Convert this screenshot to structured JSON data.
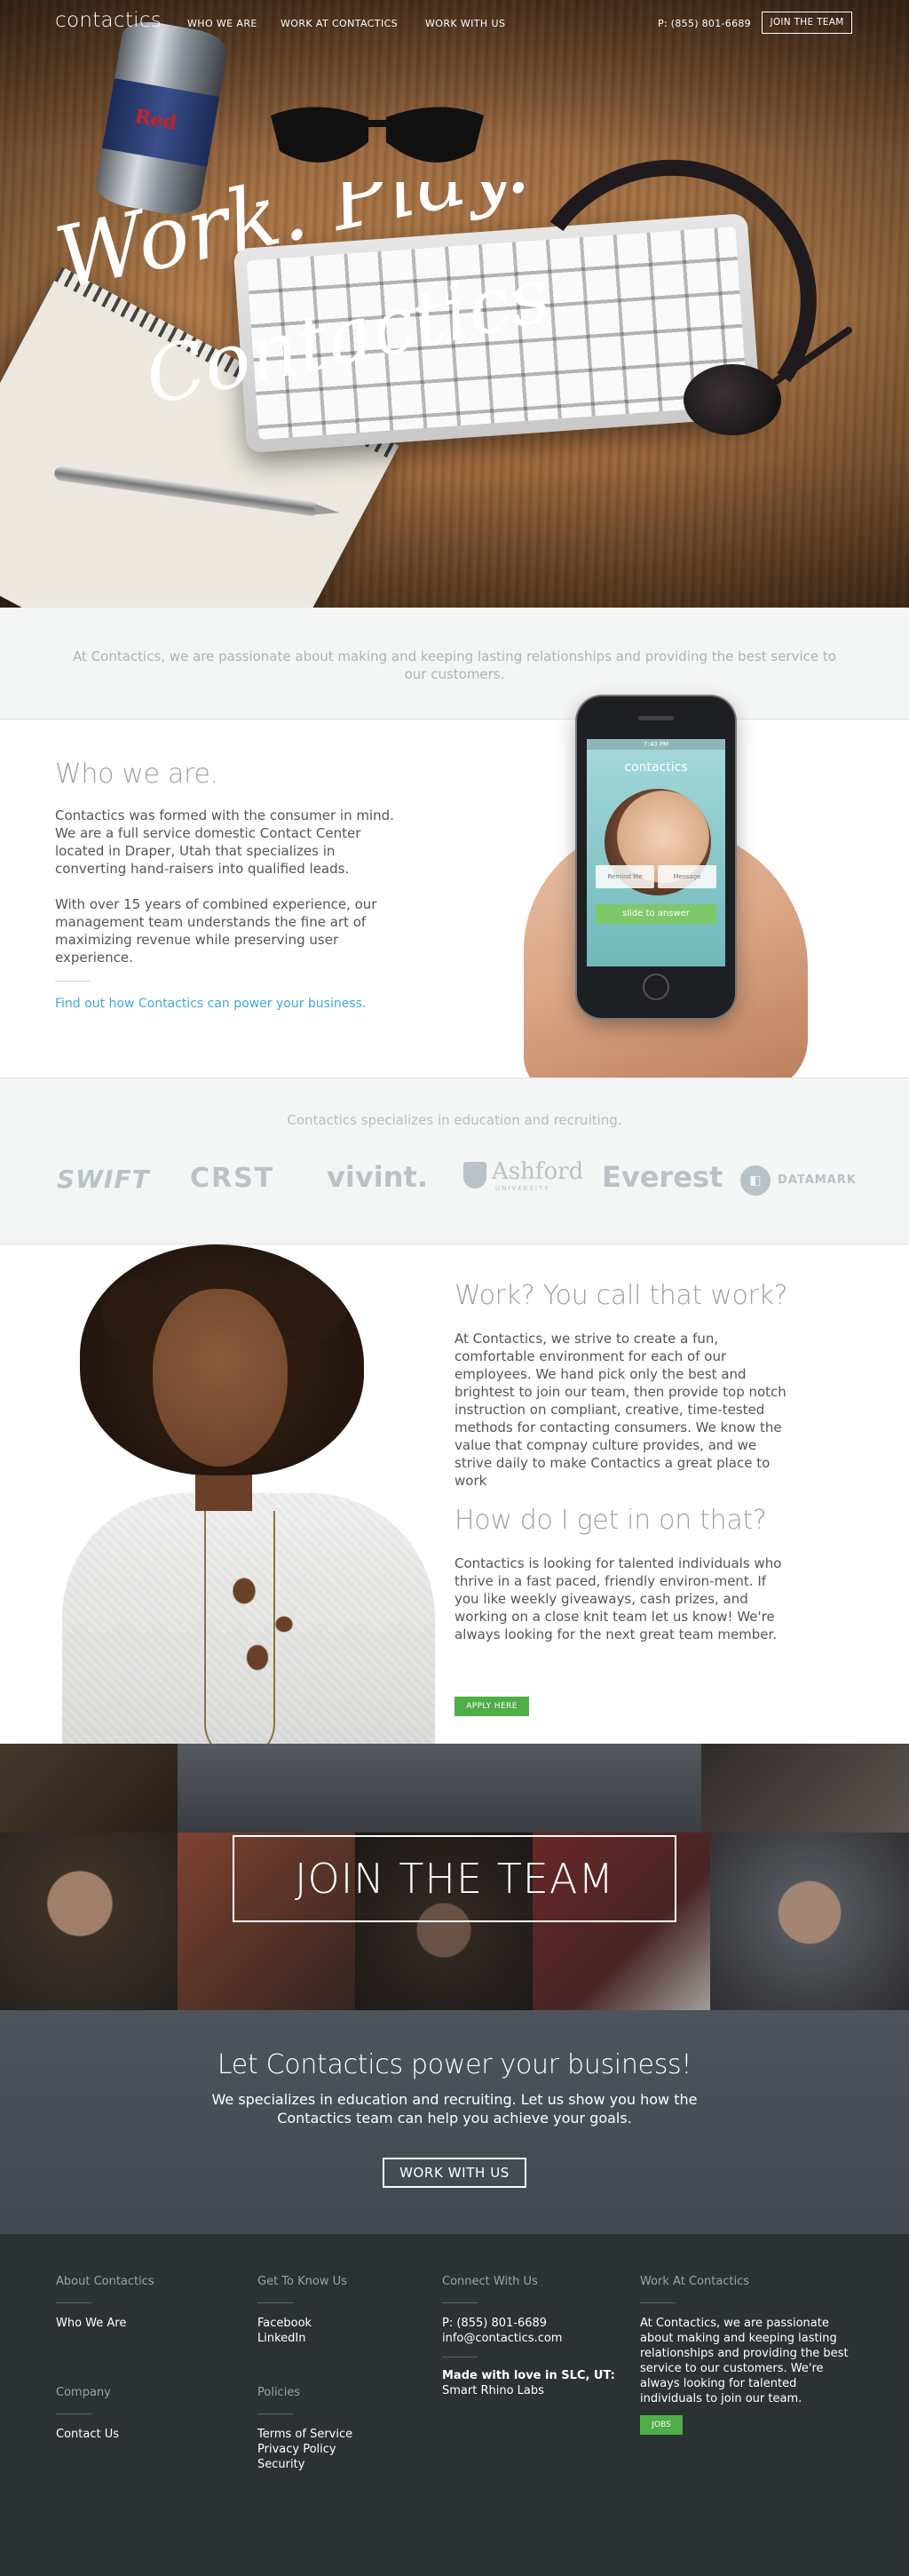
{
  "nav": {
    "logo": "contactics",
    "links": [
      "WHO WE ARE",
      "WORK AT CONTACTICS",
      "WORK WITH US"
    ],
    "phone": "P: (855) 801-6689",
    "join_button": "JOIN THE TEAM"
  },
  "hero": {
    "title_line1": "Work. Play.",
    "title_line2": "Contactics.",
    "can_label": "Red"
  },
  "intro": {
    "text": "At Contactics, we are passionate about making and keeping lasting relationships and providing the best service to our customers."
  },
  "who": {
    "heading": "Who we are.",
    "para1": "Contactics was formed with the consumer in mind. We are a full service domestic Contact Center located in Draper, Utah that specializes in converting hand-raisers into qualified leads.",
    "para2": "With over 15 years of combined experience, our management team understands the fine art of maximizing revenue while preserving user experience.",
    "link": "Find out how Contactics can power your business.",
    "phone_screen": {
      "app_name": "contactics",
      "status_time": "7:40 PM",
      "button_a": "Remind Me",
      "button_b": "Message",
      "slide": "slide to answer"
    }
  },
  "clients": {
    "caption": "Contactics specializes in education and recruiting.",
    "logos": [
      "SWIFT",
      "CRST",
      "vivint.",
      "Ashford",
      "Everest",
      "DATAMARK"
    ],
    "ashford_sub": "UNIVERSITY"
  },
  "work": {
    "heading1": "Work? You call that work?",
    "para1": "At Contactics, we strive to create a fun, comfortable environment for each of our employees. We hand pick only the best and brightest to join our team, then provide top notch instruction on compliant, creative, time-tested methods for contacting consumers. We know the value that compnay culture provides, and we strive daily to make Contactics a great place to work",
    "heading2": "How do I get in on that?",
    "para2": "Contactics is looking for talented individuals who thrive in a fast paced, friendly environ-ment. If you like weekly giveaways, cash prizes, and working on a close knit team let us know! We're always looking for the next great team member.",
    "apply_button": "APPLY HERE"
  },
  "join_banner": {
    "label": "JOIN THE TEAM"
  },
  "cta": {
    "heading": "Let Contactics power your business!",
    "text": "We specializes in education and recruiting. Let us show you how the Contactics team can help you achieve your goals.",
    "button": "WORK WITH US"
  },
  "footer": {
    "about": {
      "heading": "About Contactics",
      "links": [
        "Who We Are"
      ]
    },
    "company": {
      "heading": "Company",
      "links": [
        "Contact Us"
      ]
    },
    "know": {
      "heading": "Get To Know Us",
      "links": [
        "Facebook",
        "LinkedIn"
      ]
    },
    "policies": {
      "heading": "Policies",
      "links": [
        "Terms of Service",
        "Privacy Policy",
        "Security"
      ]
    },
    "connect": {
      "heading": "Connect With Us",
      "phone": "P: (855) 801-6689",
      "email": "info@contactics.com",
      "made_with": "Made with love in SLC, UT:",
      "agency": "Smart Rhino Labs"
    },
    "work": {
      "heading": "Work At Contactics",
      "text": "At Contactics, we are passionate about making and keeping lasting relationships and providing the best service to our customers. We're always looking for talented individuals to join our team.",
      "button": "JOBS"
    }
  },
  "colors": {
    "accent_green": "#4fae48",
    "link_blue": "#3fa7dd",
    "footer_bg": "#2c3134",
    "cta_bg": "#474e56"
  }
}
